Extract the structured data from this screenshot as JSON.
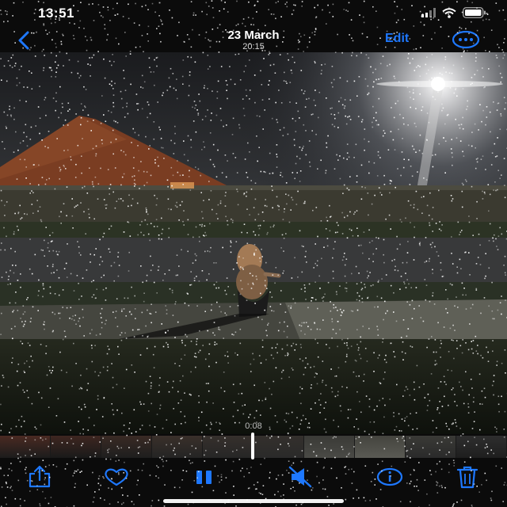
{
  "status_bar": {
    "time": "13:51",
    "icons": [
      "signal-icon",
      "wifi-icon",
      "battery-icon"
    ]
  },
  "nav_bar": {
    "back_icon": "chevron-left-icon",
    "date": "23 March",
    "time": "20:15",
    "edit_label": "Edit",
    "more_icon": "ellipsis-circle-icon"
  },
  "video": {
    "scrubber_time": "0:08"
  },
  "toolbar": {
    "icons": [
      "share-icon",
      "heart-icon",
      "pause-icon",
      "mute-icon",
      "info-icon",
      "trash-icon"
    ]
  },
  "colors": {
    "accent": "#1e78ff",
    "background": "#0b0b0b"
  }
}
